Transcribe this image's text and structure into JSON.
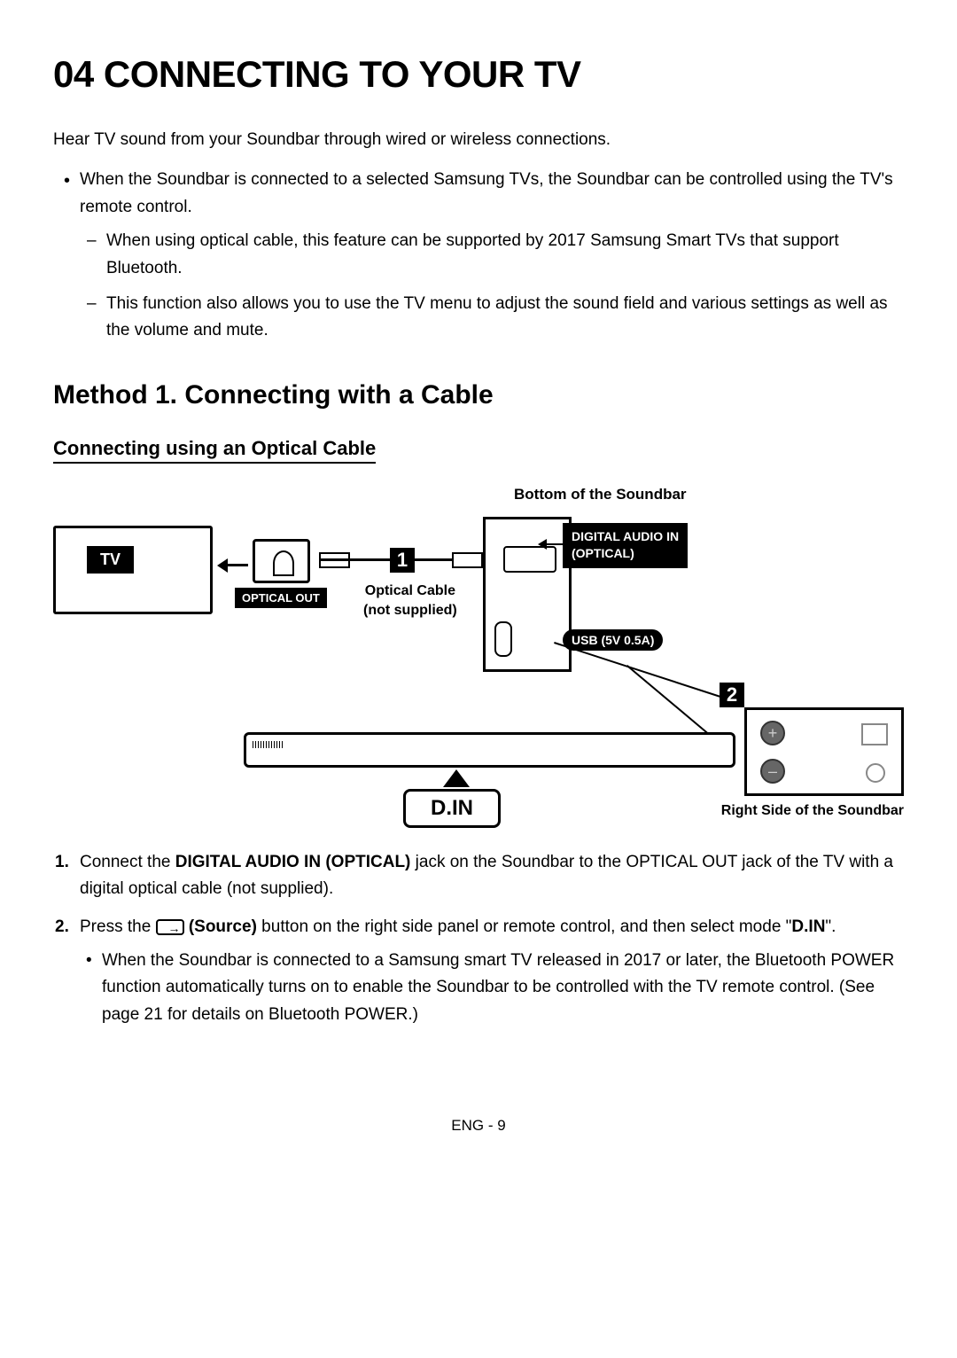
{
  "page_title": "04   CONNECTING TO YOUR TV",
  "intro": "Hear TV sound from your Soundbar through wired or wireless connections.",
  "bullet_main": "When the Soundbar is connected to a selected Samsung TVs, the Soundbar can be controlled using the TV's remote control.",
  "dash_1": "When using optical cable, this feature can be supported by 2017 Samsung Smart TVs that support Bluetooth.",
  "dash_2": "This function also allows you to use the TV menu to adjust the sound field and various settings as well as the volume and mute.",
  "section_heading": "Method 1. Connecting with a Cable",
  "sub_heading": "Connecting using an Optical Cable",
  "diagram": {
    "bottom_label": "Bottom of the Soundbar",
    "tv_label": "TV",
    "optical_out": "OPTICAL OUT",
    "step1": "1",
    "optical_cable_line1": "Optical Cable",
    "optical_cable_line2": "(not supplied)",
    "digital_audio_line1": "DIGITAL AUDIO IN",
    "digital_audio_line2": "(OPTICAL)",
    "usb_label": "USB (5V 0.5A)",
    "step2": "2",
    "din_label": "D.IN",
    "right_side_label": "Right Side of the Soundbar"
  },
  "step1_pre": "Connect the ",
  "step1_bold": "DIGITAL AUDIO IN (OPTICAL)",
  "step1_post": " jack on the Soundbar to the OPTICAL OUT jack of the TV with a digital optical cable (not supplied).",
  "step2_pre": "Press the ",
  "step2_bold": " (Source)",
  "step2_mid": " button on the right side panel or remote control, and then select mode \"",
  "step2_din": "D.IN",
  "step2_end": "\".",
  "step2_sub": "When the Soundbar is connected to a Samsung smart TV released in 2017 or later, the Bluetooth POWER function automatically turns on to enable the Soundbar to be controlled with the TV remote control. (See page 21 for details on Bluetooth POWER.)",
  "footer": "ENG - 9"
}
